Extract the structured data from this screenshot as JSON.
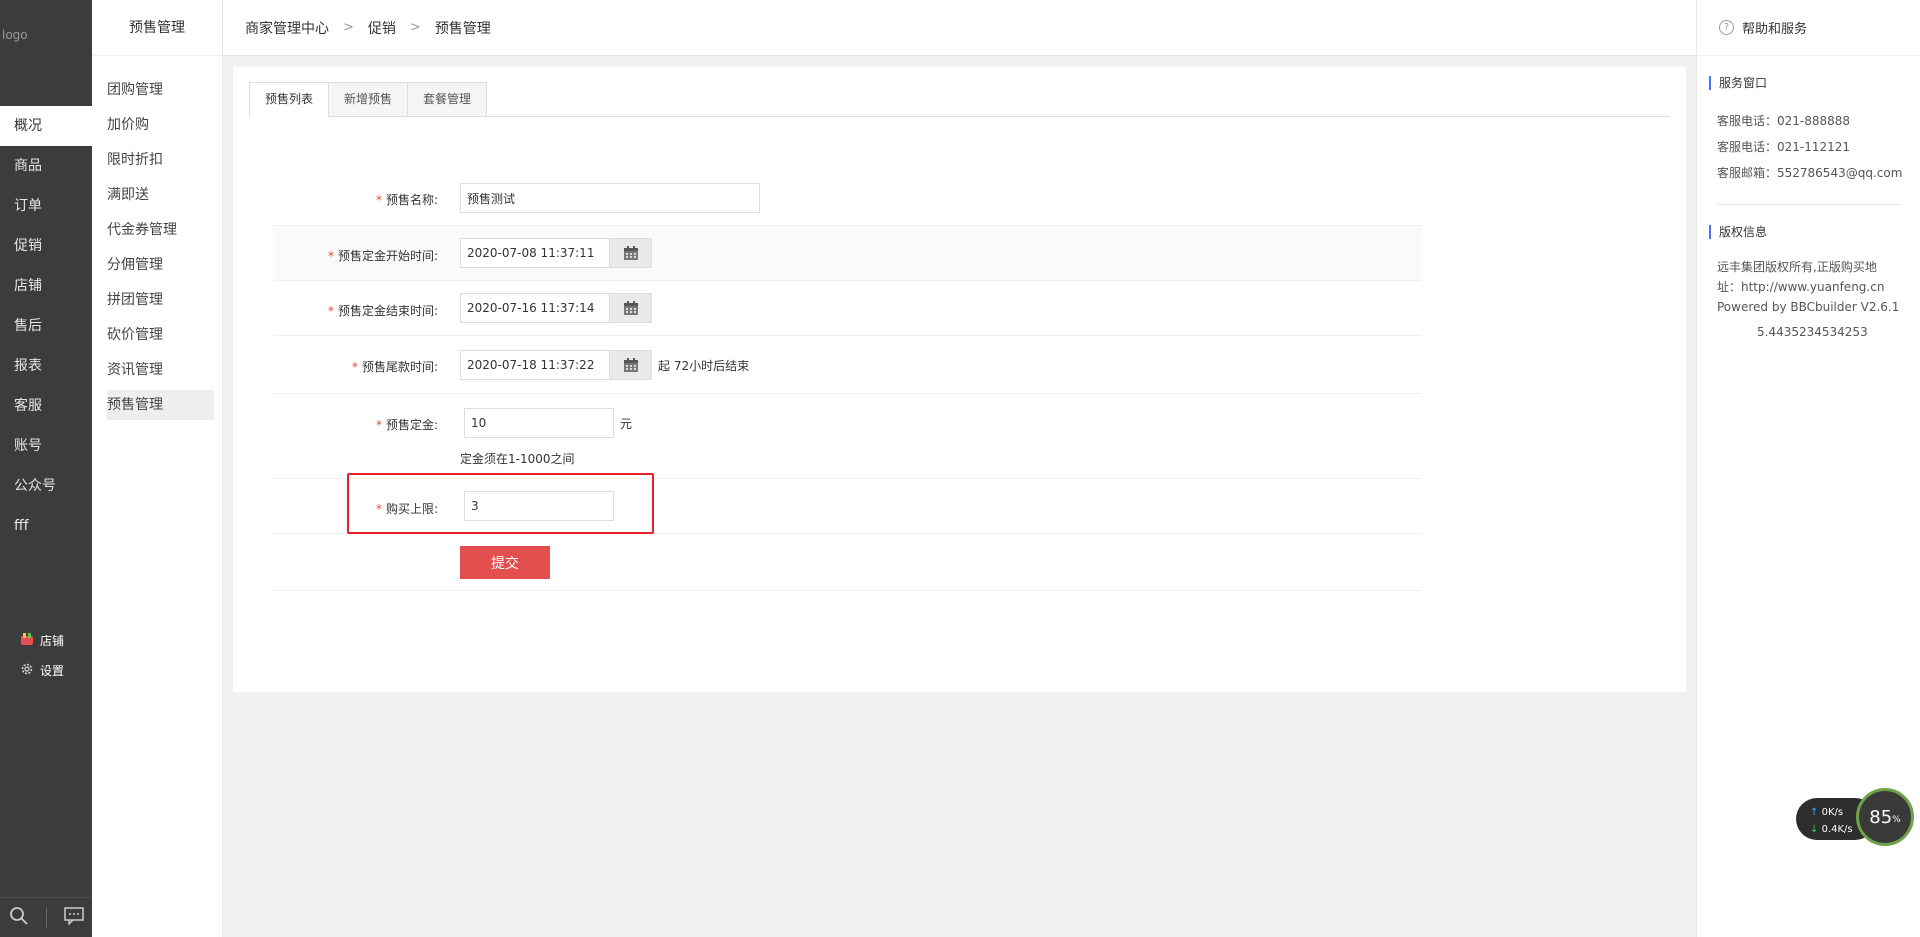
{
  "logo_alt": "logo",
  "sidebar": {
    "items": [
      "概况",
      "商品",
      "订单",
      "促销",
      "店铺",
      "售后",
      "报表",
      "客服",
      "账号",
      "公众号",
      "fff"
    ],
    "active_index": 0,
    "bottom": {
      "shop": "店铺",
      "settings": "设置"
    }
  },
  "submenu": {
    "title": "预售管理",
    "items": [
      "团购管理",
      "加价购",
      "限时折扣",
      "满即送",
      "代金券管理",
      "分佣管理",
      "拼团管理",
      "砍价管理",
      "资讯管理",
      "预售管理"
    ],
    "active_index": 9
  },
  "breadcrumb": {
    "level1": "商家管理中心",
    "level2": "促销",
    "level3": "预售管理",
    "separator": ">"
  },
  "tabs": [
    "预售列表",
    "新增预售",
    "套餐管理"
  ],
  "form": {
    "required_mark": "*",
    "name_label": "预售名称:",
    "name_value": "预售测试",
    "deposit_start_label": "预售定金开始时间:",
    "deposit_start_value": "2020-07-08 11:37:11",
    "deposit_end_label": "预售定金结束时间:",
    "deposit_end_value": "2020-07-16 11:37:14",
    "final_label": "预售尾款时间:",
    "final_value": "2020-07-18 11:37:22",
    "final_suffix": "起 72小时后结束",
    "deposit_label": "预售定金:",
    "deposit_value": "10",
    "deposit_unit": "元",
    "deposit_hint": "定金须在1-1000之间",
    "limit_label": "购买上限:",
    "limit_value": "3",
    "submit": "提交"
  },
  "right_panel": {
    "header": "帮助和服务",
    "service_title": "服务窗口",
    "phone1": "客服电话：021-888888",
    "phone2": "客服电话：021-112121",
    "email": "客服邮箱：552786543@qq.com",
    "copyright_title": "版权信息",
    "copyright_line1": "远丰集团版权所有,正版购买地",
    "copyright_line2": "址：http://www.yuanfeng.cn",
    "copyright_line3": "Powered by BBCbuilder V2.6.1",
    "version_number": "5.4435234534253"
  },
  "speed_widget": {
    "up": "0",
    "down": "0.4",
    "unit": "K/s",
    "percent": "85",
    "percent_sign": "%"
  },
  "colors": {
    "accent_red": "#e34f4f",
    "highlight": "#e8202a",
    "sidebar_bg": "#3c3c3c",
    "blue_mark": "#3d78ff"
  }
}
